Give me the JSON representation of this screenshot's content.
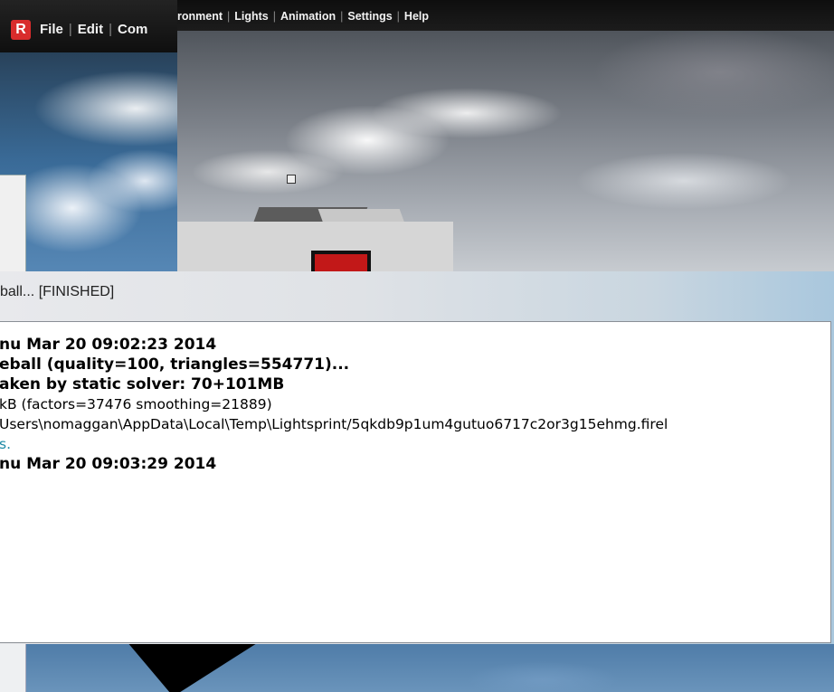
{
  "app": {
    "logo_letter": "R",
    "logo_color": "#d92c2c"
  },
  "back_window": {
    "menu": [
      "File",
      "Edit",
      "Com"
    ]
  },
  "viewport_window": {
    "menu": [
      "ronment",
      "Lights",
      "Animation",
      "Settings",
      "Help"
    ]
  },
  "log_window": {
    "caption": "ball... [FINISHED]",
    "lines": [
      {
        "style": "bold",
        "text": "nu Mar 20 09:02:23 2014"
      },
      {
        "style": "bold",
        "text": "eball (quality=100, triangles=554771)..."
      },
      {
        "style": "bold",
        "text": "aken by static solver: 70+101MB"
      },
      {
        "style": "normal",
        "text": "kB (factors=37476 smoothing=21889)"
      },
      {
        "style": "normal",
        "text": "Users\\nomaggan\\AppData\\Local\\Temp\\Lightsprint/5qkdb9p1um4gutuo6717c2or3g15ehmg.firel"
      },
      {
        "style": "link",
        "text": "s."
      },
      {
        "style": "bold",
        "text": "nu Mar 20 09:03:29 2014"
      }
    ]
  }
}
